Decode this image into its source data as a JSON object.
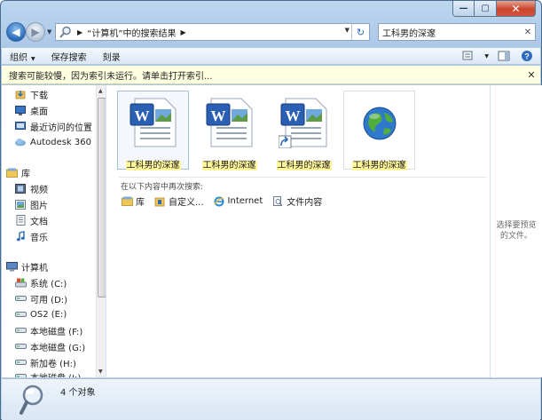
{
  "window": {
    "minimize_glyph": "—",
    "maximize_glyph": "▢",
    "close_glyph": "✕"
  },
  "navigation": {
    "back_glyph": "◀",
    "forward_glyph": "▶",
    "address_segments": [
      "“计算机”中的搜索结果"
    ],
    "refresh_glyph": "↻",
    "search_value": "工科男的深邃",
    "search_clear_glyph": "✕"
  },
  "toolbar": {
    "organize": "组织",
    "save_search": "保存搜索",
    "burn": "刻录"
  },
  "infobar": {
    "text": "搜索可能较慢，因为索引未运行。请单击打开索引...",
    "close_glyph": "✕"
  },
  "sidebar": {
    "items": [
      {
        "label": "下载",
        "icon": "downloads-folder-icon"
      },
      {
        "label": "桌面",
        "icon": "desktop-icon"
      },
      {
        "label": "最近访问的位置",
        "icon": "recent-places-icon"
      },
      {
        "label": "Autodesk 360",
        "icon": "autodesk-cloud-icon"
      },
      {
        "label": "库",
        "icon": "library-icon"
      },
      {
        "label": "视频",
        "icon": "video-library-icon"
      },
      {
        "label": "图片",
        "icon": "pictures-library-icon"
      },
      {
        "label": "文档",
        "icon": "documents-library-icon"
      },
      {
        "label": "音乐",
        "icon": "music-library-icon"
      },
      {
        "label": "计算机",
        "icon": "computer-icon"
      },
      {
        "label": "系统 (C:)",
        "icon": "system-drive-icon"
      },
      {
        "label": "可用 (D:)",
        "icon": "drive-icon"
      },
      {
        "label": "OS2 (E:)",
        "icon": "drive-icon"
      },
      {
        "label": "本地磁盘 (F:)",
        "icon": "drive-icon"
      },
      {
        "label": "本地磁盘 (G:)",
        "icon": "drive-icon"
      },
      {
        "label": "新加卷 (H:)",
        "icon": "drive-icon"
      },
      {
        "label": "本地磁盘 (I:)",
        "icon": "drive-icon"
      }
    ]
  },
  "results": {
    "files": [
      {
        "name": "工科男的深邃",
        "icon": "word-document-icon",
        "selected": true
      },
      {
        "name": "工科男的深邃",
        "icon": "word-document-icon",
        "selected": false
      },
      {
        "name": "工科男的深邃",
        "icon": "word-document-shortcut-icon",
        "selected": false
      },
      {
        "name": "工科男的深邃",
        "icon": "internet-globe-icon",
        "selected": false
      }
    ],
    "search_again_label": "在以下内容中再次搜索:",
    "search_again_links": [
      {
        "label": "库",
        "icon": "library-icon"
      },
      {
        "label": "自定义...",
        "icon": "custom-folder-icon"
      },
      {
        "label": "Internet",
        "icon": "internet-explorer-icon"
      },
      {
        "label": "文件内容",
        "icon": "file-contents-icon"
      }
    ]
  },
  "preview": {
    "text": "选择要预览的文件。"
  },
  "status": {
    "count_text": "4 个对象"
  }
}
